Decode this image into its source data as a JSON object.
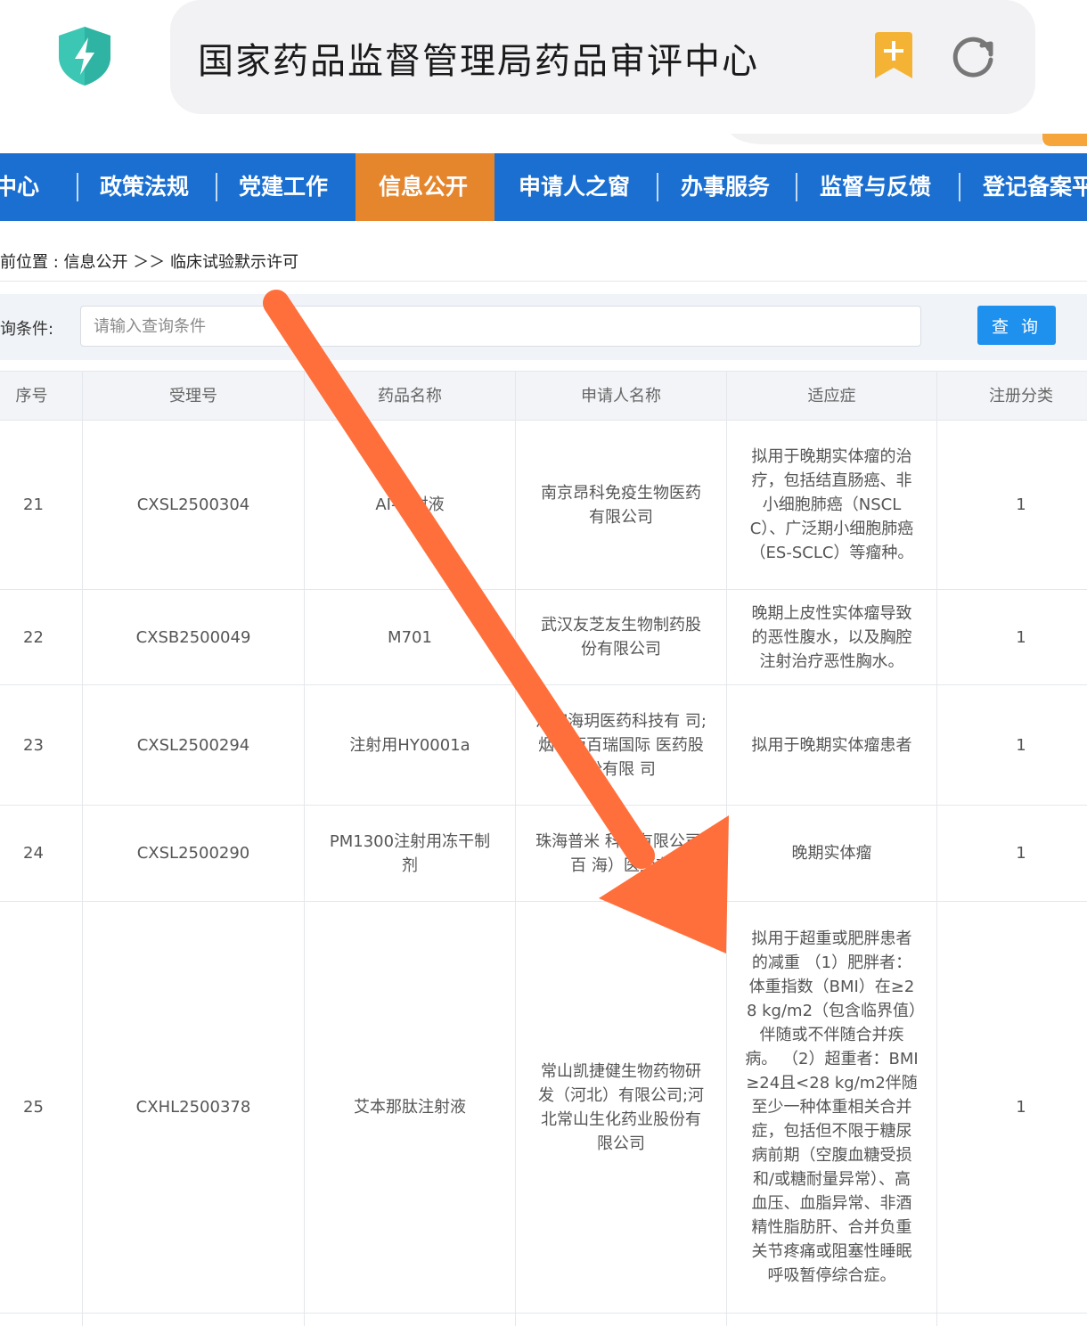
{
  "browser": {
    "url_title": "国家药品监督管理局药品审评中心",
    "colors": {
      "shield": "#3cc6b4",
      "bookmark": "#f5b335"
    }
  },
  "nav": {
    "items": [
      {
        "label": "中心"
      },
      {
        "label": "政策法规"
      },
      {
        "label": "党建工作"
      },
      {
        "label": "信息公开",
        "active": true
      },
      {
        "label": "申请人之窗"
      },
      {
        "label": "办事服务"
      },
      {
        "label": "监督与反馈"
      },
      {
        "label": "登记备案平"
      }
    ],
    "colors": {
      "bar": "#1a6fd1",
      "active": "#e5862d"
    }
  },
  "breadcrumb": {
    "text": "前位置 : 信息公开 ＞＞ 临床试验默示许可"
  },
  "search": {
    "label": "询条件:",
    "placeholder": "请输入查询条件",
    "button": "查 询"
  },
  "table": {
    "headers": [
      "序号",
      "受理号",
      "药品名称",
      "申请人名称",
      "适应症",
      "注册分类"
    ],
    "rows": [
      {
        "seq": "21",
        "acceptance_no": "CXSL2500304",
        "drug": "AI-0 射液",
        "applicant": "南京昂科免疫生物医药有限公司",
        "indication": "拟用于晚期实体瘤的治疗，包括结直肠癌、非小细胞肺癌（NSCLC）、广泛期小细胞肺癌（ES-SCLC）等瘤种。",
        "category": "1"
      },
      {
        "seq": "22",
        "acceptance_no": "CXSB2500049",
        "drug": "M701",
        "applicant": "武汉友芝友生物制药股份有限公司",
        "indication": "晚期上皮性实体瘤导致的恶性腹水，以及胸腔注射治疗恶性胸水。",
        "category": "1"
      },
      {
        "seq": "23",
        "acceptance_no": "CXSL2500294",
        "drug": "注射用HY0001a",
        "applicant": "汇宇海玥医药科技有 司;烟台迈百瑞国际 医药股份有限 司",
        "indication": "拟用于晚期实体瘤患者",
        "category": "1"
      },
      {
        "seq": "24",
        "acceptance_no": "CXSL2500290",
        "drug": "PM1300注射用冻干制剂",
        "applicant": "珠海普米 科技有限公司;百 海）医药有",
        "indication": "晚期实体瘤",
        "category": "1"
      },
      {
        "seq": "25",
        "acceptance_no": "CXHL2500378",
        "drug": "艾本那肽注射液",
        "applicant": "常山凯捷健生物药物研发（河北）有限公司;河北常山生化药业股份有限公司",
        "indication": "拟用于超重或肥胖患者的减重 （1）肥胖者：体重指数（BMI）在≥28 kg/m2（包含临界值）伴随或不伴随合并疾病。 （2）超重者：BMI≥24且<28 kg/m2伴随至少一种体重相关合并症，包括但不限于糖尿病前期（空腹血糖受损和/或糖耐量异常）、高血压、血脂异常、非酒精性脂肪肝、合并负重关节疼痛或阻塞性睡眠呼吸暂停综合症。",
        "category": "1"
      }
    ]
  },
  "annotation": {
    "arrow_color": "#ff6f3c"
  }
}
